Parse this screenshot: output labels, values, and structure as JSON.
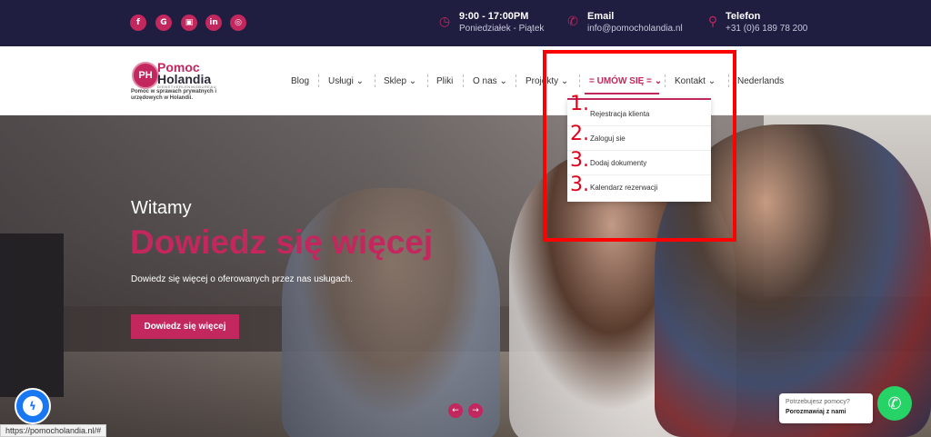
{
  "topbar": {
    "social": [
      "f",
      "G",
      "▣",
      "in",
      "◎"
    ],
    "hours": {
      "title": "9:00 - 17:00PM",
      "sub": "Poniedziałek - Piątek"
    },
    "email": {
      "title": "Email",
      "sub": "info@pomocholandia.nl"
    },
    "phone": {
      "title": "Telefon",
      "sub": "+31 (0)6 189 78 200"
    }
  },
  "logo": {
    "mark": "PH",
    "line1": "Pomoc",
    "line2": "Holandia",
    "line3": "DIENSTVERLENINGBUREAU",
    "tagline": "Pomoc w sprawach prywatnych i urzędowych w Holandii."
  },
  "nav": {
    "blog": "Blog",
    "uslugi": "Usługi",
    "sklep": "Sklep",
    "pliki": "Pliki",
    "onas": "O nas",
    "projekty": "Projekty",
    "umow": "= UMÓW SIĘ =",
    "kontakt": "Kontakt",
    "lang": "Nederlands",
    "chevron": "⌄"
  },
  "dropdown": {
    "items": [
      "Rejestracja klienta",
      "Zaloguj sie",
      "Dodaj dokumenty",
      "Kalendarz rezerwacji"
    ],
    "annotations": [
      "1.",
      "2.",
      "3.",
      "3."
    ]
  },
  "hero": {
    "welcome": "Witamy",
    "title": "Dowiedz się więcej",
    "subtitle": "Dowiedz się więcej o oferowanych przez nas usługach.",
    "button": "Dowiedz się więcej",
    "prev": "←",
    "next": "→"
  },
  "chat": {
    "line1": "Potrzebujesz pomocy?",
    "line2": "Porozmawiaj z nami"
  },
  "status_url": "https://pomocholandia.nl/#",
  "colors": {
    "accent": "#c2275e",
    "topbar": "#1f1d40",
    "annotation": "#ff0000"
  }
}
